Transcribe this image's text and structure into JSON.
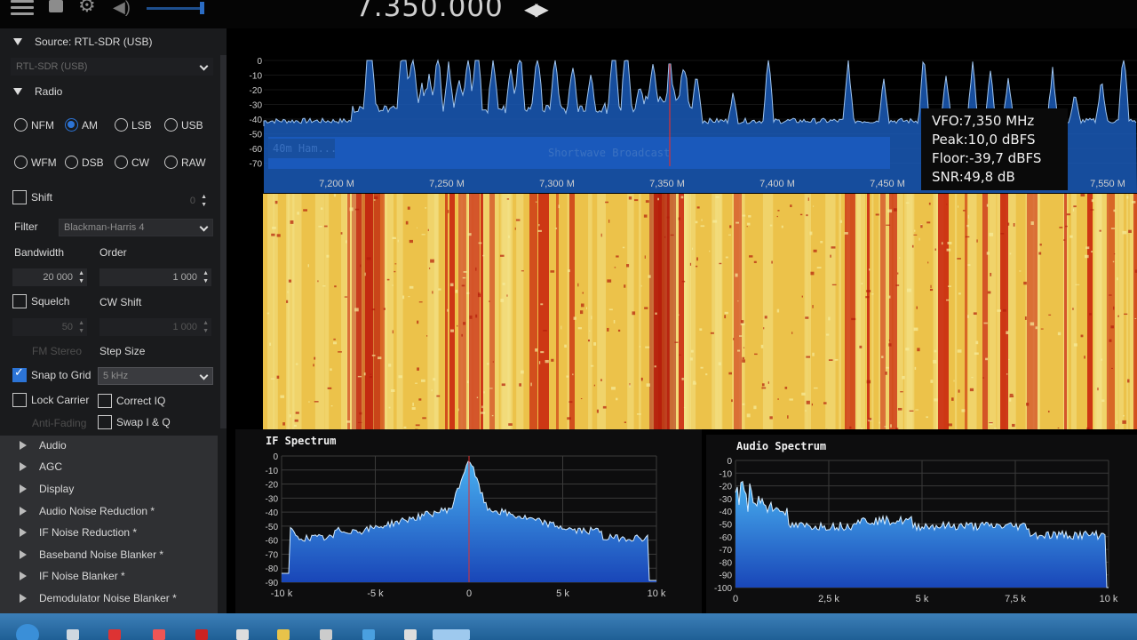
{
  "topbar": {
    "frequency": "7.350.000",
    "freq_arrows": "◀▶",
    "menu_icon": "hamburger-icon",
    "stop_icon": "stop-icon",
    "settings_icon": "gear-icon",
    "volume_icon": "speaker-icon"
  },
  "menu": {
    "source_header": "Source: RTL-SDR (USB)",
    "source_select": "RTL-SDR (USB)",
    "radio_header": "Radio",
    "modes": [
      "NFM",
      "AM",
      "LSB",
      "USB",
      "WFM",
      "DSB",
      "CW",
      "RAW"
    ],
    "selected_mode": "AM",
    "shift_label": "Shift",
    "shift_value": "0",
    "filter_label": "Filter",
    "filter_value": "Blackman-Harris 4",
    "bandwidth_label": "Bandwidth",
    "bandwidth_value": "20 000",
    "order_label": "Order",
    "order_value": "1 000",
    "squelch_label": "Squelch",
    "squelch_value": "50",
    "cwshift_label": "CW Shift",
    "cwshift_value": "1 000",
    "fmstereo_label": "FM Stereo",
    "stepsize_label": "Step Size",
    "snap_label": "Snap to Grid",
    "step_value": "5 kHz",
    "lockcarrier_label": "Lock Carrier",
    "correctiq_label": "Correct IQ",
    "antifading_label": "Anti-Fading",
    "swapiq_label": "Swap I & Q",
    "sections": [
      "Audio",
      "AGC",
      "Display",
      "Audio Noise Reduction *",
      "IF Noise Reduction *",
      "Baseband Noise Blanker *",
      "IF Noise Blanker *",
      "Demodulator Noise Blanker *"
    ]
  },
  "fft": {
    "y_ticks": [
      "0",
      "-10",
      "-20",
      "-30",
      "-40",
      "-50",
      "-60",
      "-70"
    ],
    "x_ticks": [
      "7,200 M",
      "7,250 M",
      "7,300 M",
      "7,350 M",
      "7,400 M",
      "7,450 M",
      "7,500 M",
      "7,550 M"
    ],
    "band_label_1": "40m Ham...",
    "band_label_2": "Shortwave Broadcast",
    "tooltip": {
      "vfo": "VFO:7,350 MHz",
      "peak": "Peak:10,0 dBFS",
      "floor": "Floor:-39,7 dBFS",
      "snr": "SNR:49,8 dB"
    }
  },
  "if_spectrum": {
    "title": "IF Spectrum",
    "y_ticks": [
      "0",
      "-10",
      "-20",
      "-30",
      "-40",
      "-50",
      "-60",
      "-70",
      "-80",
      "-90"
    ],
    "x_ticks": [
      "-10 k",
      "-5 k",
      "0",
      "5 k",
      "10 k"
    ]
  },
  "audio_spectrum": {
    "title": "Audio Spectrum",
    "y_ticks": [
      "0",
      "-10",
      "-20",
      "-30",
      "-40",
      "-50",
      "-60",
      "-70",
      "-80",
      "-90",
      "-100"
    ],
    "x_ticks": [
      "0",
      "2,5 k",
      "5 k",
      "7,5 k",
      "10 k"
    ]
  },
  "colors": {
    "accent": "#2c74d6",
    "spectrum_fill": "#1d63c2",
    "band_bar": "#1f4fc9",
    "waterfall_hot": "#c81e0a",
    "waterfall_warm": "#e9b52a"
  }
}
